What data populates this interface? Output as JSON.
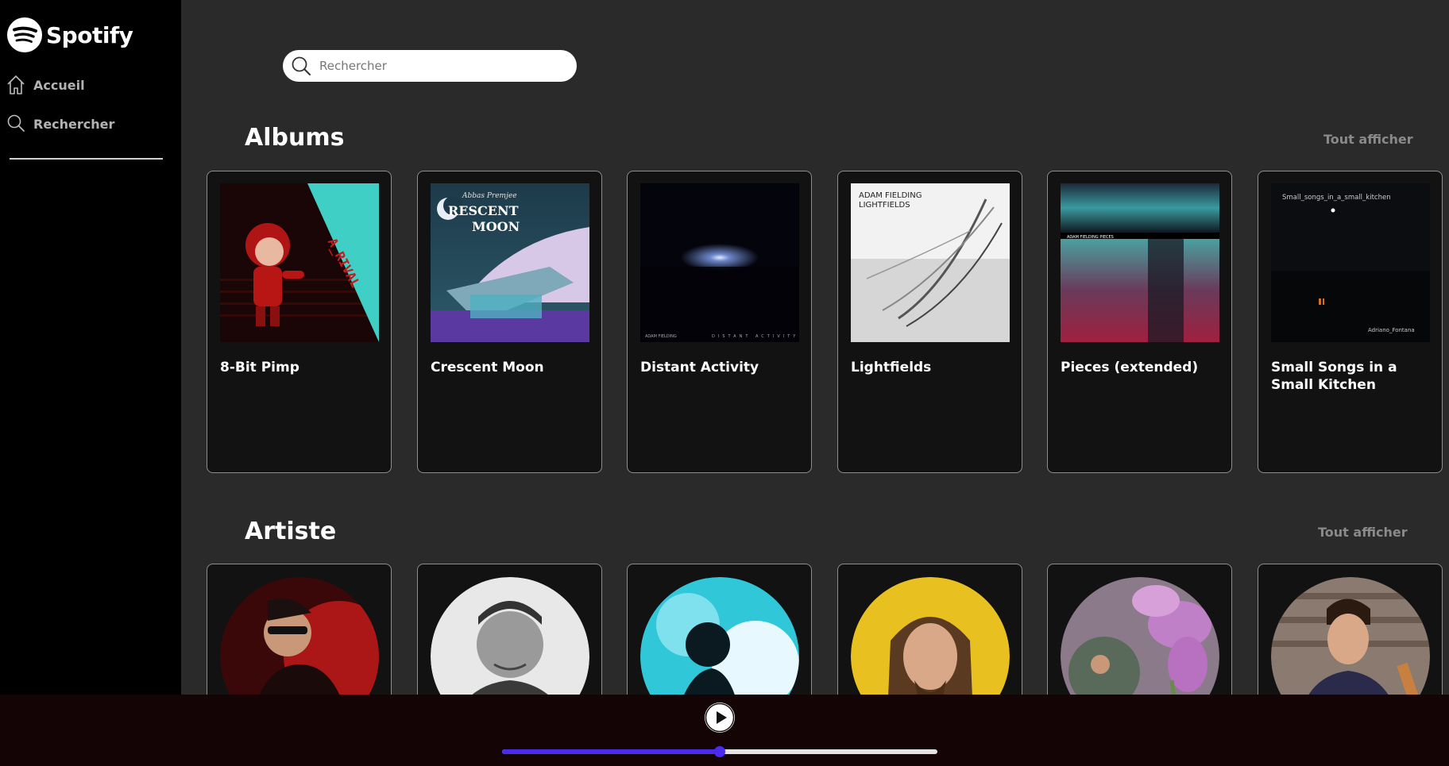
{
  "app": {
    "name": "Spotify"
  },
  "sidebar": {
    "items": [
      {
        "label": "Accueil",
        "icon": "home-icon"
      },
      {
        "label": "Rechercher",
        "icon": "search-icon"
      }
    ]
  },
  "search": {
    "placeholder": "Rechercher",
    "value": ""
  },
  "albums": {
    "title": "Albums",
    "see_all": "Tout afficher",
    "items": [
      {
        "title": "8-Bit Pimp",
        "cover_text": "A_RIVAL · 8-BIT PIMP"
      },
      {
        "title": "Crescent Moon",
        "cover_text": "Abbas Premjee · CRESCENT MOON"
      },
      {
        "title": "Distant Activity",
        "cover_text": "ADAM FIELDING · DISTANT ACTIVITY"
      },
      {
        "title": "Lightfields",
        "cover_text": "ADAM FIELDING · LIGHTFIELDS"
      },
      {
        "title": "Pieces (extended)",
        "cover_text": "ADAM FIELDING PIECES"
      },
      {
        "title": "Small Songs in a Small Kitchen",
        "cover_text": "Small_songs_in_a_small_kitchen",
        "cover_text2": "Adriano_Fontana"
      }
    ]
  },
  "artists": {
    "title": "Artiste",
    "see_all": "Tout afficher"
  },
  "player": {
    "progress": 0.5
  },
  "colors": {
    "sidebar_bg": "#000000",
    "main_bg": "#2a2a2a",
    "card_bg": "#121212",
    "player_bg": "#140405",
    "progress_accent": "#4a2bf0"
  }
}
